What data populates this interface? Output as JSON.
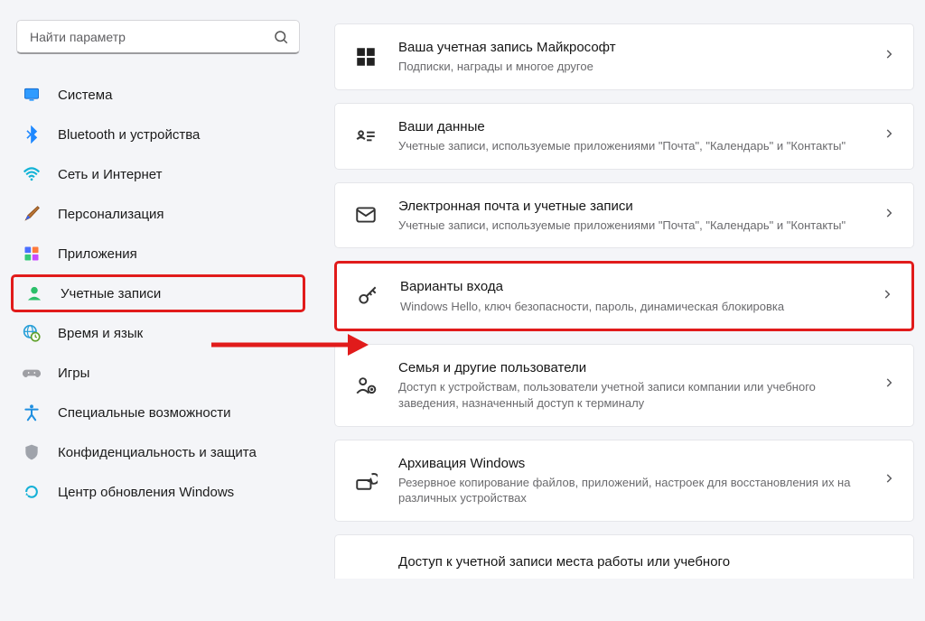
{
  "search": {
    "placeholder": "Найти параметр"
  },
  "sidebar": {
    "items": [
      {
        "id": "system",
        "label": "Система"
      },
      {
        "id": "bluetooth",
        "label": "Bluetooth и устройства"
      },
      {
        "id": "network",
        "label": "Сеть и Интернет"
      },
      {
        "id": "personalization",
        "label": "Персонализация"
      },
      {
        "id": "apps",
        "label": "Приложения"
      },
      {
        "id": "accounts",
        "label": "Учетные записи"
      },
      {
        "id": "time",
        "label": "Время и язык"
      },
      {
        "id": "gaming",
        "label": "Игры"
      },
      {
        "id": "accessibility",
        "label": "Специальные возможности"
      },
      {
        "id": "privacy",
        "label": "Конфиденциальность и защита"
      },
      {
        "id": "update",
        "label": "Центр обновления Windows"
      }
    ]
  },
  "content": {
    "cards": [
      {
        "title": "Ваша учетная запись Майкрософт",
        "sub": "Подписки, награды и многое другое"
      },
      {
        "title": "Ваши данные",
        "sub": "Учетные записи, используемые приложениями \"Почта\", \"Календарь\" и \"Контакты\""
      },
      {
        "title": "Электронная почта и учетные записи",
        "sub": "Учетные записи, используемые приложениями \"Почта\", \"Календарь\" и \"Контакты\""
      },
      {
        "title": "Варианты входа",
        "sub": "Windows Hello, ключ безопасности, пароль, динамическая блокировка"
      },
      {
        "title": "Семья и другие пользователи",
        "sub": "Доступ к устройствам, пользователи учетной записи компании или учебного заведения, назначенный доступ к терминалу"
      },
      {
        "title": "Архивация Windows",
        "sub": "Резервное копирование файлов, приложений, настроек для восстановления их на различных устройствах"
      },
      {
        "title": "Доступ к учетной записи места работы или учебного",
        "sub": ""
      }
    ]
  },
  "colors": {
    "highlight": "#e11b1b"
  }
}
